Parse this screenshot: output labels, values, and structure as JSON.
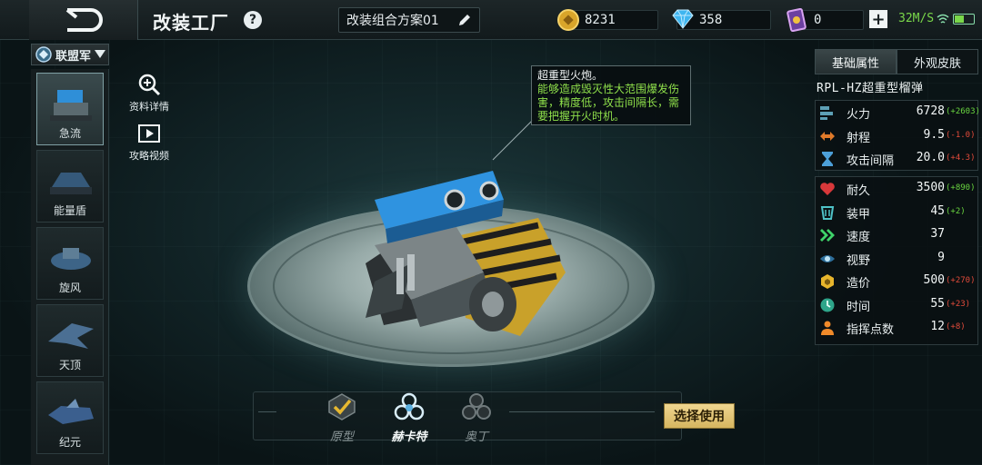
{
  "header": {
    "title": "改装工厂",
    "help_label": "?",
    "preset_name": "改装组合方案01",
    "resources": {
      "gold": "8231",
      "diamond": "358",
      "card": "0"
    },
    "network": "32M/S",
    "add_label": "+"
  },
  "sidebar": {
    "faction": "联盟军",
    "units": [
      {
        "label": "急流"
      },
      {
        "label": "能量盾"
      },
      {
        "label": "旋风"
      },
      {
        "label": "天顶"
      },
      {
        "label": "纪元"
      }
    ],
    "actions": {
      "details": "资料详情",
      "video": "攻略视频"
    }
  },
  "callout": {
    "title": "超重型火炮。",
    "description": "能够造成毁灭性大范围爆发伤害，精度低，攻击间隔长，需要把握开火时机。"
  },
  "variants": [
    {
      "label": "原型"
    },
    {
      "label": "赫卡特"
    },
    {
      "label": "奥丁"
    }
  ],
  "use_button": "选择使用",
  "panel": {
    "tabs": [
      "基础属性",
      "外观皮肤"
    ],
    "unit_name": "RPL-HZ超重型榴弹",
    "attack_stats": [
      {
        "label": "火力",
        "value": "6728",
        "delta": "(+2603)",
        "delta_type": "pos",
        "icon": "firepower-icon"
      },
      {
        "label": "射程",
        "value": "9.5",
        "delta": "(-1.0)",
        "delta_type": "neg",
        "icon": "range-icon"
      },
      {
        "label": "攻击间隔",
        "value": "20.0",
        "delta": "(+4.3)",
        "delta_type": "neg",
        "icon": "hourglass-icon"
      }
    ],
    "defense_stats": [
      {
        "label": "耐久",
        "value": "3500",
        "delta": "(+890)",
        "delta_type": "pos",
        "icon": "heart-icon"
      },
      {
        "label": "装甲",
        "value": "45",
        "delta": "(+2)",
        "delta_type": "pos",
        "icon": "armor-icon"
      },
      {
        "label": "速度",
        "value": "37",
        "delta": "",
        "delta_type": "pos",
        "icon": "speed-icon"
      },
      {
        "label": "视野",
        "value": "9",
        "delta": "",
        "delta_type": "pos",
        "icon": "eye-icon"
      },
      {
        "label": "造价",
        "value": "500",
        "delta": "(+270)",
        "delta_type": "neg",
        "icon": "cost-icon"
      },
      {
        "label": "时间",
        "value": "55",
        "delta": "(+23)",
        "delta_type": "neg",
        "icon": "clock-icon"
      },
      {
        "label": "指挥点数",
        "value": "12",
        "delta": "(+8)",
        "delta_type": "neg",
        "icon": "command-icon"
      }
    ]
  },
  "colors": {
    "accent_green": "#8fe04b",
    "delta_positive": "#6ad640",
    "delta_negative": "#e24b3b",
    "button_gold": "#e6c875"
  }
}
